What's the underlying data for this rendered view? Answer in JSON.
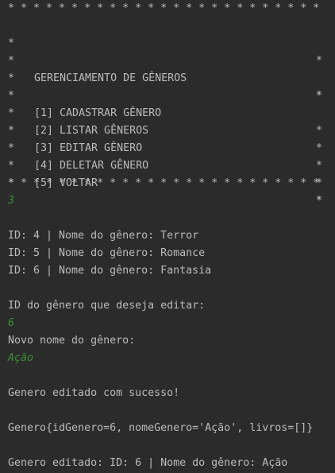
{
  "menu": {
    "border_top": "* * * * * * * * * * * * * * * * * * * * * * * * *",
    "border_bottom": "* * * * * * * * * * * * * * * * * * * * * * * * *",
    "side_char": "*",
    "title": "GERENCIAMENTO DE GÊNEROS",
    "options": [
      "[1] CADASTRAR GÊNERO",
      "[2] LISTAR GÊNEROS",
      "[3] EDITAR GÊNERO",
      "[4] DELETAR GÊNERO",
      "[5] VOLTAR"
    ]
  },
  "session": {
    "menu_choice": "3",
    "genres": [
      "ID: 4 | Nome do gênero: Terror",
      "ID: 5 | Nome do gênero: Romance",
      "ID: 6 | Nome do gênero: Fantasia"
    ],
    "prompt_id": "ID do gênero que deseja editar:",
    "input_id": "6",
    "prompt_name": "Novo nome do gênero:",
    "input_name": "Ação",
    "success_message": "Genero editado com sucesso!",
    "object_dump": "Genero{idGenero=6, nomeGenero='Ação', livros=[]}",
    "final_message": "Genero editado: ID: 6 | Nome do gênero: Ação"
  },
  "colors": {
    "background": "#2b2b2b",
    "output_text": "#bbbbbb",
    "input_text": "#3c8f36"
  }
}
